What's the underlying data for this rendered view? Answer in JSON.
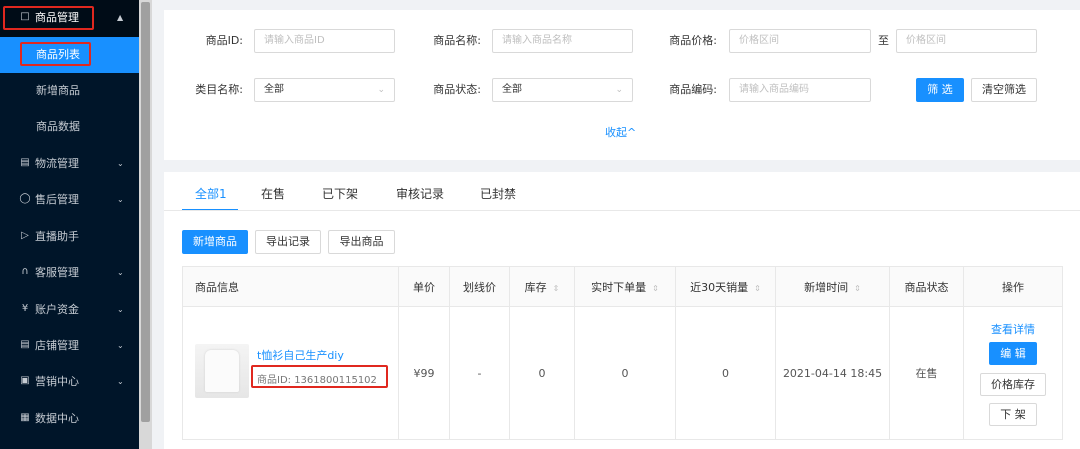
{
  "sidebar": {
    "items": [
      {
        "label": "商品管理",
        "icon": "bag-icon"
      },
      {
        "label": "物流管理",
        "icon": "truck-icon"
      },
      {
        "label": "售后管理",
        "icon": "shield-icon"
      },
      {
        "label": "直播助手",
        "icon": "video-icon"
      },
      {
        "label": "客服管理",
        "icon": "headset-icon"
      },
      {
        "label": "账户资金",
        "icon": "yen-circle-icon"
      },
      {
        "label": "店铺管理",
        "icon": "store-icon"
      },
      {
        "label": "营销中心",
        "icon": "monitor-icon"
      },
      {
        "label": "数据中心",
        "icon": "chart-icon"
      }
    ],
    "sub_items": [
      "商品列表",
      "新增商品",
      "商品数据"
    ]
  },
  "filter": {
    "product_id_label": "商品ID:",
    "product_id_placeholder": "请输入商品ID",
    "product_name_label": "商品名称:",
    "product_name_placeholder": "请输入商品名称",
    "price_label": "商品价格:",
    "price_placeholder": "价格区间",
    "price_to": "至",
    "category_label": "类目名称:",
    "category_value": "全部",
    "status_label": "商品状态:",
    "status_value": "全部",
    "code_label": "商品编码:",
    "code_placeholder": "请输入商品编码",
    "filter_button": "筛 选",
    "clear_button": "清空筛选",
    "collapse": "收起^"
  },
  "tabs": [
    "全部1",
    "在售",
    "已下架",
    "审核记录",
    "已封禁"
  ],
  "actions": {
    "add": "新增商品",
    "export_records": "导出记录",
    "export_products": "导出商品"
  },
  "table": {
    "headers": [
      "商品信息",
      "单价",
      "划线价",
      "库存",
      "实时下单量",
      "近30天销量",
      "新增时间",
      "商品状态",
      "操作"
    ],
    "rows": [
      {
        "name": "t恤衫自己生产diy",
        "id_text": "商品ID:  1361800115102",
        "price": "¥99",
        "strike_price": "-",
        "stock": "0",
        "realtime_orders": "0",
        "sales_30d": "0",
        "created": "2021-04-14 18:45",
        "status": "在售",
        "op_detail": "查看详情",
        "op_edit": "编 辑",
        "op_stock": "价格库存",
        "op_offshelf": "下 架"
      }
    ]
  },
  "colors": {
    "accent": "#1890ff",
    "sidebar": "#001529",
    "highlight_box": "#e0281f"
  }
}
